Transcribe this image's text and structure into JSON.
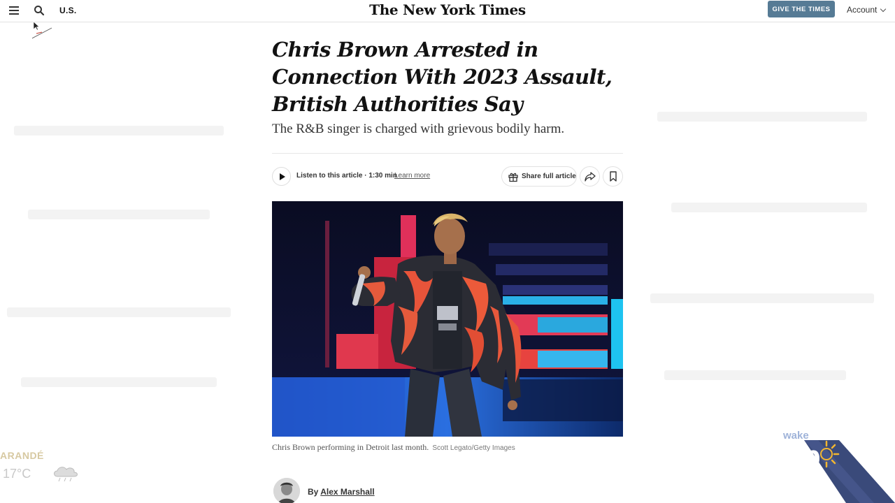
{
  "header": {
    "section": "U.S.",
    "logo": "The New York Times",
    "give_button": "GIVE THE TIMES",
    "account": "Account"
  },
  "article": {
    "headline": "Chris Brown Arrested in Connection With 2023 Assault, British Authorities Say",
    "summary": "The R&B singer is charged with grievous bodily harm.",
    "toolbar": {
      "listen": "Listen to this article · 1:30 min",
      "learn_more": "Learn more",
      "share": "Share full article"
    },
    "photo": {
      "caption": "Chris Brown performing in Detroit last month.",
      "credit": "Scott Legato/Getty Images"
    },
    "byline": {
      "prefix": "By",
      "author": "Alex Marshall"
    }
  },
  "overlay": {
    "weather_city": "ARANDÉ",
    "weather_temp": "17°C",
    "show_logo": "wake up"
  },
  "colors": {
    "give_button": "#567b95",
    "show_logo_band": "#3a4a7a"
  }
}
